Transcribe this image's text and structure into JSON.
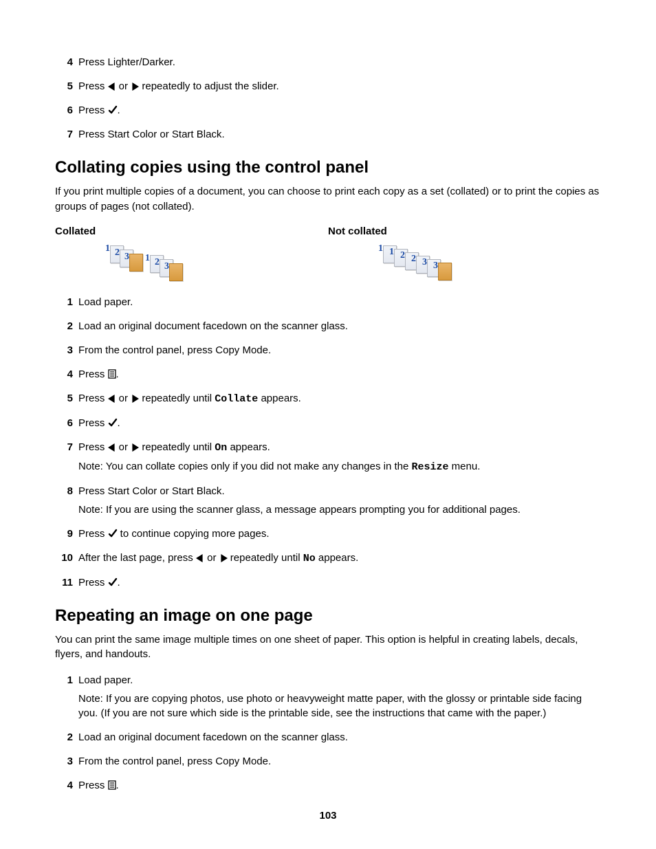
{
  "pageNumber": "103",
  "topSteps": [
    {
      "n": "4",
      "parts": [
        {
          "t": "Press "
        },
        {
          "t": "Lighter/Darker",
          "b": true
        },
        {
          "t": "."
        }
      ]
    },
    {
      "n": "5",
      "parts": [
        {
          "t": "Press "
        },
        {
          "icon": "left"
        },
        {
          "t": " or "
        },
        {
          "icon": "right"
        },
        {
          "t": " repeatedly to adjust the slider."
        }
      ]
    },
    {
      "n": "6",
      "parts": [
        {
          "t": "Press "
        },
        {
          "icon": "check"
        },
        {
          "t": "."
        }
      ]
    },
    {
      "n": "7",
      "parts": [
        {
          "t": "Press "
        },
        {
          "t": "Start Color",
          "b": true
        },
        {
          "t": " or "
        },
        {
          "t": "Start Black",
          "b": true
        },
        {
          "t": "."
        }
      ]
    }
  ],
  "section1": {
    "title": "Collating copies using the control panel",
    "intro": "If you print multiple copies of a document, you can choose to print each copy as a set (collated) or to print the copies as groups of pages (not collated).",
    "colTitles": {
      "collated": "Collated",
      "notCollated": "Not collated"
    },
    "collatedLabels": [
      "1",
      "2",
      "3",
      "1",
      "2",
      "3"
    ],
    "notCollatedLabels": [
      "1",
      "1",
      "2",
      "2",
      "3",
      "3"
    ],
    "steps": [
      {
        "n": "1",
        "parts": [
          {
            "t": "Load paper."
          }
        ]
      },
      {
        "n": "2",
        "parts": [
          {
            "t": "Load an original document facedown on the scanner glass."
          }
        ]
      },
      {
        "n": "3",
        "parts": [
          {
            "t": "From the control panel, press "
          },
          {
            "t": "Copy Mode",
            "b": true
          },
          {
            "t": "."
          }
        ]
      },
      {
        "n": "4",
        "parts": [
          {
            "t": "Press "
          },
          {
            "icon": "menu"
          },
          {
            "t": "."
          }
        ]
      },
      {
        "n": "5",
        "parts": [
          {
            "t": "Press "
          },
          {
            "icon": "left"
          },
          {
            "t": " or "
          },
          {
            "icon": "right"
          },
          {
            "t": " repeatedly until "
          },
          {
            "t": "Collate",
            "m": true
          },
          {
            "t": " appears."
          }
        ]
      },
      {
        "n": "6",
        "parts": [
          {
            "t": "Press "
          },
          {
            "icon": "check"
          },
          {
            "t": "."
          }
        ]
      },
      {
        "n": "7",
        "parts": [
          {
            "t": "Press "
          },
          {
            "icon": "left"
          },
          {
            "t": " or "
          },
          {
            "icon": "right"
          },
          {
            "t": " repeatedly until "
          },
          {
            "t": "On",
            "m": true
          },
          {
            "t": " appears."
          }
        ],
        "note": [
          {
            "t": "Note:",
            "b": true
          },
          {
            "t": " You can collate copies only if you did not make any changes in the "
          },
          {
            "t": "Resize",
            "m": true
          },
          {
            "t": " menu."
          }
        ]
      },
      {
        "n": "8",
        "parts": [
          {
            "t": "Press "
          },
          {
            "t": "Start Color",
            "b": true
          },
          {
            "t": " or "
          },
          {
            "t": "Start Black",
            "b": true
          },
          {
            "t": "."
          }
        ],
        "note": [
          {
            "t": "Note:",
            "b": true
          },
          {
            "t": " If you are using the scanner glass, a message appears prompting you for additional pages."
          }
        ]
      },
      {
        "n": "9",
        "parts": [
          {
            "t": "Press "
          },
          {
            "icon": "check"
          },
          {
            "t": " to continue copying more pages."
          }
        ]
      },
      {
        "n": "10",
        "parts": [
          {
            "t": "After the last page, press "
          },
          {
            "icon": "left"
          },
          {
            "t": " or "
          },
          {
            "icon": "right"
          },
          {
            "t": " repeatedly until "
          },
          {
            "t": "No",
            "m": true
          },
          {
            "t": " appears."
          }
        ]
      },
      {
        "n": "11",
        "parts": [
          {
            "t": "Press "
          },
          {
            "icon": "check"
          },
          {
            "t": "."
          }
        ]
      }
    ]
  },
  "section2": {
    "title": "Repeating an image on one page",
    "intro": "You can print the same image multiple times on one sheet of paper. This option is helpful in creating labels, decals, flyers, and handouts.",
    "steps": [
      {
        "n": "1",
        "parts": [
          {
            "t": "Load paper."
          }
        ],
        "note": [
          {
            "t": "Note:",
            "b": true
          },
          {
            "t": "  If you are copying photos, use photo or heavyweight matte paper, with the glossy or printable side facing you. (If you are not sure which side is the printable side, see the instructions that came with the paper.)"
          }
        ]
      },
      {
        "n": "2",
        "parts": [
          {
            "t": "Load an original document facedown on the scanner glass."
          }
        ]
      },
      {
        "n": "3",
        "parts": [
          {
            "t": "From the control panel, press "
          },
          {
            "t": "Copy Mode",
            "b": true
          },
          {
            "t": "."
          }
        ]
      },
      {
        "n": "4",
        "parts": [
          {
            "t": "Press "
          },
          {
            "icon": "menu"
          },
          {
            "t": "."
          }
        ]
      }
    ]
  }
}
